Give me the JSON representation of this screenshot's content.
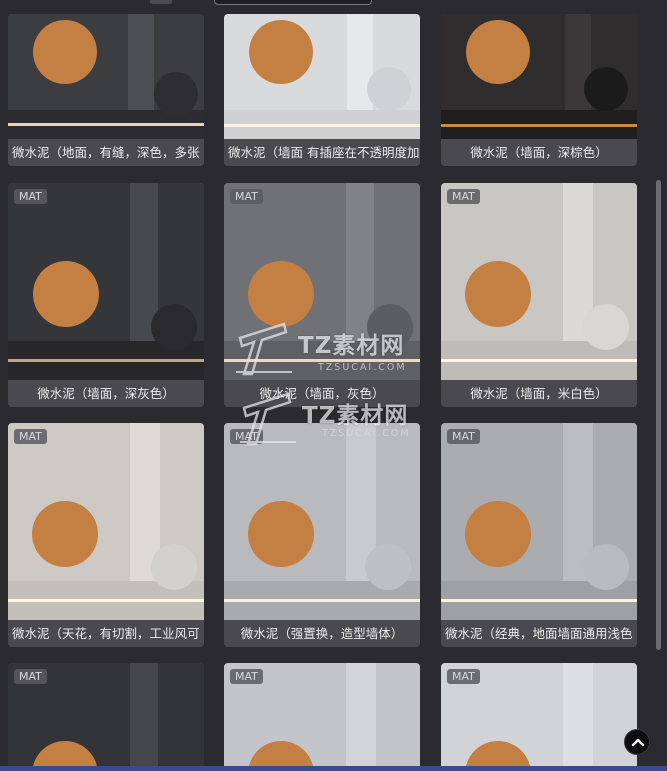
{
  "badge_label": "MAT",
  "cards": [
    {
      "title": "微水泥（地面，有缝，深色，多张"
    },
    {
      "title": "微水泥（墙面 有插座在不透明度加"
    },
    {
      "title": "微水泥（墙面，深棕色）"
    },
    {
      "title": "微水泥（墙面，深灰色）"
    },
    {
      "title": "微水泥（墙面，灰色）"
    },
    {
      "title": "微水泥（墙面，米白色）"
    },
    {
      "title": "微水泥（天花，有切割，工业风可"
    },
    {
      "title": "微水泥（强置换，造型墙体）"
    },
    {
      "title": "微水泥（经典，地面墙面通用浅色"
    }
  ],
  "watermark": {
    "brand": "TZ素材网",
    "domain": "TZSUCAI.COM"
  },
  "icons": {
    "back_to_top": "chevron-up-icon"
  },
  "colors": {
    "page_bg": "#2b2a2f",
    "card_bg": "#4a494f",
    "sphere": "#c8803f",
    "accent_strip": "#3a4a8a"
  }
}
